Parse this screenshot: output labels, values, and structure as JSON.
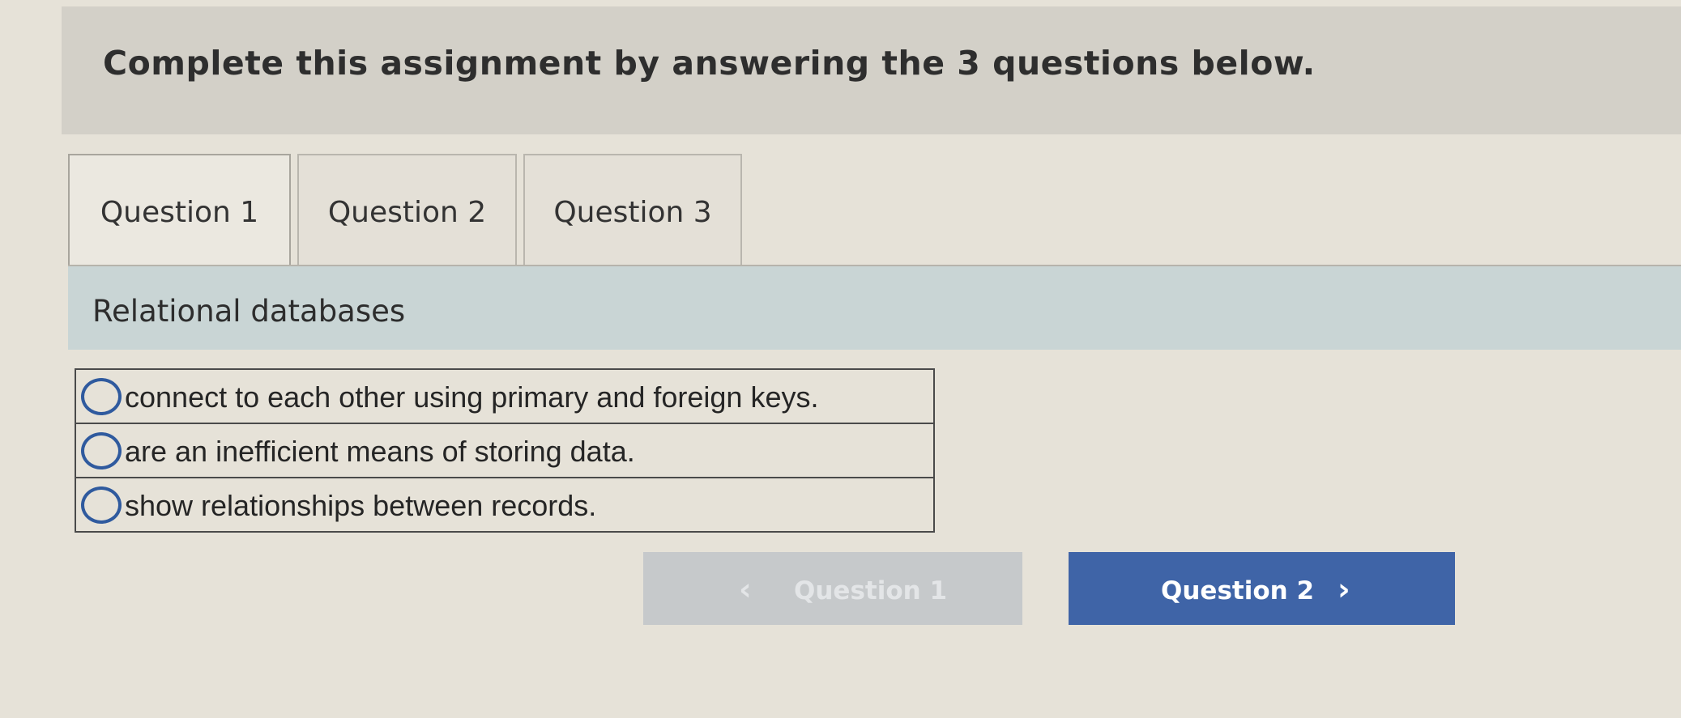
{
  "header": {
    "title": "Complete this assignment by answering the 3 questions below."
  },
  "tabs": [
    {
      "label": "Question 1",
      "active": true
    },
    {
      "label": "Question 2",
      "active": false
    },
    {
      "label": "Question 3",
      "active": false
    }
  ],
  "question": {
    "prompt": "Relational databases",
    "options": [
      {
        "text": "connect to each other using primary and foreign keys.",
        "selected": false
      },
      {
        "text": "are an inefficient means of storing data.",
        "selected": false
      },
      {
        "text": "show relationships between records.",
        "selected": false
      }
    ]
  },
  "navigation": {
    "prev_label": "Question 1",
    "prev_icon": "chevron-left-icon",
    "prev_disabled": true,
    "next_label": "Question 2",
    "next_icon": "chevron-right-icon"
  },
  "colors": {
    "primary_button": "#3f64a7",
    "disabled_button": "#c6c9cb",
    "radio_border": "#2f5a9e",
    "prompt_background": "#c9d5d5"
  }
}
